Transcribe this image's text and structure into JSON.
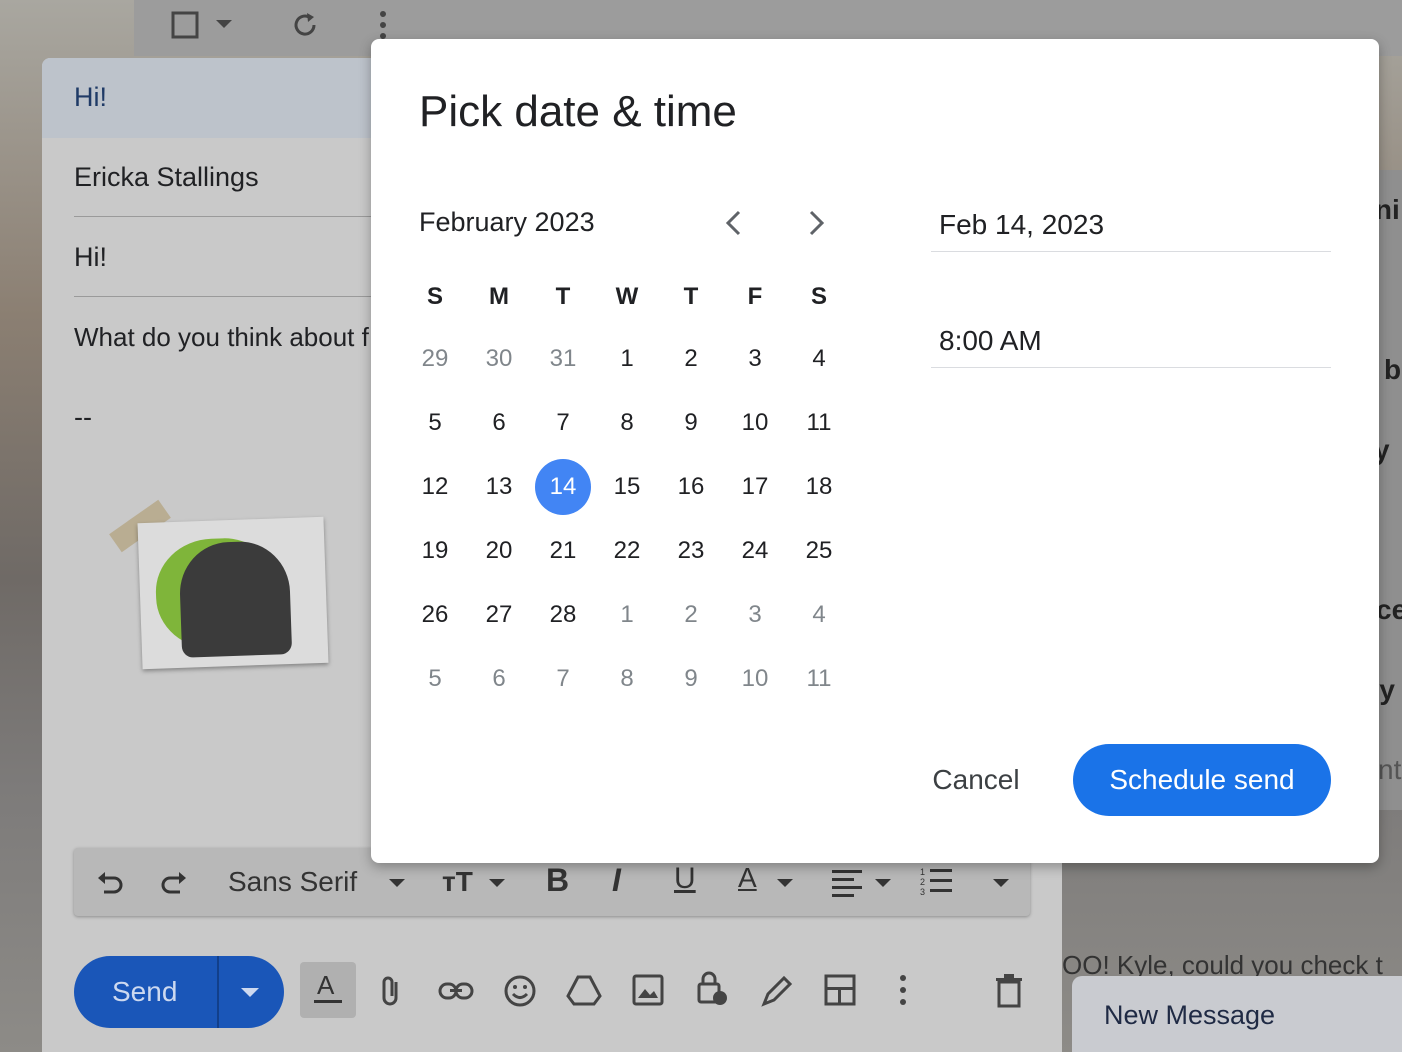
{
  "background": {
    "compose": {
      "subject": "Hi!",
      "to": "Ericka Stallings",
      "subject_field": "Hi!",
      "body": "What do you think about f",
      "signature": "--"
    },
    "right_fragments": [
      "rni",
      "b",
      "y",
      "ce",
      "ty",
      "nt"
    ],
    "snippet": "OO! Kyle, could you check t",
    "format_bar": {
      "font": "Sans Serif"
    },
    "send_label": "Send",
    "new_message": "New Message"
  },
  "dialog": {
    "title": "Pick date & time",
    "month_label": "February 2023",
    "weekdays": [
      "S",
      "M",
      "T",
      "W",
      "T",
      "F",
      "S"
    ],
    "weeks": [
      [
        "29",
        "30",
        "31",
        "1",
        "2",
        "3",
        "4"
      ],
      [
        "5",
        "6",
        "7",
        "8",
        "9",
        "10",
        "11"
      ],
      [
        "12",
        "13",
        "14",
        "15",
        "16",
        "17",
        "18"
      ],
      [
        "19",
        "20",
        "21",
        "22",
        "23",
        "24",
        "25"
      ],
      [
        "26",
        "27",
        "28",
        "1",
        "2",
        "3",
        "4"
      ],
      [
        "5",
        "6",
        "7",
        "8",
        "9",
        "10",
        "11"
      ]
    ],
    "selected_day": "14",
    "date_value": "Feb 14, 2023",
    "time_value": "8:00 AM",
    "cancel_label": "Cancel",
    "schedule_label": "Schedule send"
  },
  "colors": {
    "accent": "#1a73e8",
    "selected_day_bg": "#4285f4"
  }
}
